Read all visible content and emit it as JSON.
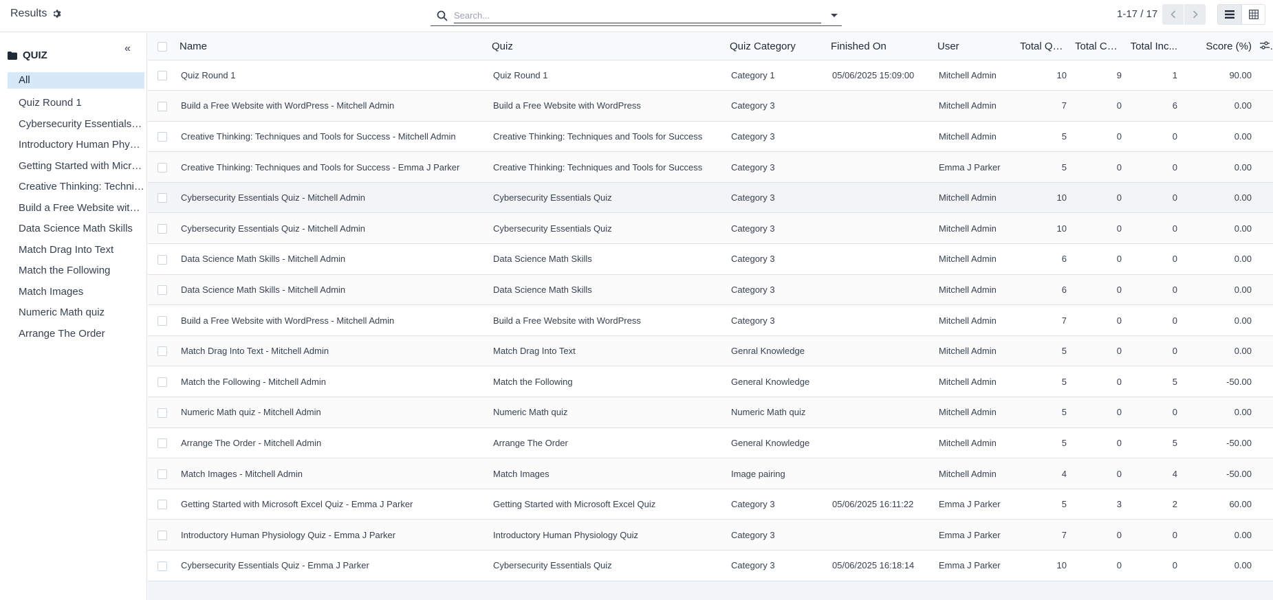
{
  "header": {
    "breadcrumb": "Results",
    "search_placeholder": "Search...",
    "pager": "1-17 / 17"
  },
  "sidebar": {
    "title": "QUIZ",
    "items": [
      {
        "label": "All"
      },
      {
        "label": "Quiz Round 1"
      },
      {
        "label": "Cybersecurity Essentials Quiz"
      },
      {
        "label": "Introductory Human Physiology Quiz"
      },
      {
        "label": "Getting Started with Microsoft Excel Quiz"
      },
      {
        "label": "Creative Thinking: Techniques and Tools for Success"
      },
      {
        "label": "Build a Free Website with WordPress"
      },
      {
        "label": "Data Science Math Skills"
      },
      {
        "label": "Match Drag Into Text"
      },
      {
        "label": "Match the Following"
      },
      {
        "label": "Match Images"
      },
      {
        "label": "Numeric Math quiz"
      },
      {
        "label": "Arrange The Order"
      }
    ]
  },
  "table": {
    "columns": {
      "name": "Name",
      "quiz": "Quiz",
      "category": "Quiz Category",
      "finished": "Finished On",
      "user": "User",
      "total_q": "Total Qu...",
      "total_correct": "Total Cor...",
      "total_incorrect": "Total Inc...",
      "score": "Score (%)"
    },
    "rows": [
      {
        "name": "Quiz Round 1",
        "quiz": "Quiz Round 1",
        "category": "Category 1",
        "finished": "05/06/2025 15:09:00",
        "user": "Mitchell Admin",
        "total_q": "10",
        "correct": "9",
        "incorrect": "1",
        "score": "90.00"
      },
      {
        "name": "Build a Free Website with WordPress - Mitchell Admin",
        "quiz": "Build a Free Website with WordPress",
        "category": "Category 3",
        "finished": "",
        "user": "Mitchell Admin",
        "total_q": "7",
        "correct": "0",
        "incorrect": "6",
        "score": "0.00"
      },
      {
        "name": "Creative Thinking: Techniques and Tools for Success - Mitchell Admin",
        "quiz": "Creative Thinking: Techniques and Tools for Success",
        "category": "Category 3",
        "finished": "",
        "user": "Mitchell Admin",
        "total_q": "5",
        "correct": "0",
        "incorrect": "0",
        "score": "0.00"
      },
      {
        "name": "Creative Thinking: Techniques and Tools for Success - Emma J Parker",
        "quiz": "Creative Thinking: Techniques and Tools for Success",
        "category": "Category 3",
        "finished": "",
        "user": "Emma J Parker",
        "total_q": "5",
        "correct": "0",
        "incorrect": "0",
        "score": "0.00"
      },
      {
        "name": "Cybersecurity Essentials Quiz - Mitchell Admin",
        "quiz": "Cybersecurity Essentials Quiz",
        "category": "Category 3",
        "finished": "",
        "user": "Mitchell Admin",
        "total_q": "10",
        "correct": "0",
        "incorrect": "0",
        "score": "0.00"
      },
      {
        "name": "Cybersecurity Essentials Quiz - Mitchell Admin",
        "quiz": "Cybersecurity Essentials Quiz",
        "category": "Category 3",
        "finished": "",
        "user": "Mitchell Admin",
        "total_q": "10",
        "correct": "0",
        "incorrect": "0",
        "score": "0.00"
      },
      {
        "name": "Data Science Math Skills - Mitchell Admin",
        "quiz": "Data Science Math Skills",
        "category": "Category 3",
        "finished": "",
        "user": "Mitchell Admin",
        "total_q": "6",
        "correct": "0",
        "incorrect": "0",
        "score": "0.00"
      },
      {
        "name": "Data Science Math Skills - Mitchell Admin",
        "quiz": "Data Science Math Skills",
        "category": "Category 3",
        "finished": "",
        "user": "Mitchell Admin",
        "total_q": "6",
        "correct": "0",
        "incorrect": "0",
        "score": "0.00"
      },
      {
        "name": "Build a Free Website with WordPress - Mitchell Admin",
        "quiz": "Build a Free Website with WordPress",
        "category": "Category 3",
        "finished": "",
        "user": "Mitchell Admin",
        "total_q": "7",
        "correct": "0",
        "incorrect": "0",
        "score": "0.00"
      },
      {
        "name": "Match Drag Into Text - Mitchell Admin",
        "quiz": "Match Drag Into Text",
        "category": "Genral Knowledge",
        "finished": "",
        "user": "Mitchell Admin",
        "total_q": "5",
        "correct": "0",
        "incorrect": "0",
        "score": "0.00"
      },
      {
        "name": "Match the Following - Mitchell Admin",
        "quiz": "Match the Following",
        "category": "General Knowledge",
        "finished": "",
        "user": "Mitchell Admin",
        "total_q": "5",
        "correct": "0",
        "incorrect": "5",
        "score": "-50.00"
      },
      {
        "name": "Numeric Math quiz - Mitchell Admin",
        "quiz": "Numeric Math quiz",
        "category": "Numeric Math quiz",
        "finished": "",
        "user": "Mitchell Admin",
        "total_q": "5",
        "correct": "0",
        "incorrect": "0",
        "score": "0.00"
      },
      {
        "name": "Arrange The Order - Mitchell Admin",
        "quiz": "Arrange The Order",
        "category": "General Knowledge",
        "finished": "",
        "user": "Mitchell Admin",
        "total_q": "5",
        "correct": "0",
        "incorrect": "5",
        "score": "-50.00"
      },
      {
        "name": "Match Images - Mitchell Admin",
        "quiz": "Match Images",
        "category": "Image pairing",
        "finished": "",
        "user": "Mitchell Admin",
        "total_q": "4",
        "correct": "0",
        "incorrect": "4",
        "score": "-50.00"
      },
      {
        "name": "Getting Started with Microsoft Excel Quiz - Emma J Parker",
        "quiz": "Getting Started with Microsoft Excel Quiz",
        "category": "Category 3",
        "finished": "05/06/2025 16:11:22",
        "user": "Emma J Parker",
        "total_q": "5",
        "correct": "3",
        "incorrect": "2",
        "score": "60.00"
      },
      {
        "name": "Introductory Human Physiology Quiz - Emma J Parker",
        "quiz": "Introductory Human Physiology Quiz",
        "category": "Category 3",
        "finished": "",
        "user": "Emma J Parker",
        "total_q": "7",
        "correct": "0",
        "incorrect": "0",
        "score": "0.00"
      },
      {
        "name": "Cybersecurity Essentials Quiz - Emma J Parker",
        "quiz": "Cybersecurity Essentials Quiz",
        "category": "Category 3",
        "finished": "05/06/2025 16:18:14",
        "user": "Emma J Parker",
        "total_q": "10",
        "correct": "0",
        "incorrect": "0",
        "score": "0.00"
      }
    ]
  },
  "icons": {
    "settings": "gear-icon",
    "search": "search-icon",
    "folder": "folder-icon"
  },
  "colors": {
    "active_item_bg": "#d5e9f8",
    "border": "#dee2e6",
    "footer_bg": "#f1f5f9"
  }
}
